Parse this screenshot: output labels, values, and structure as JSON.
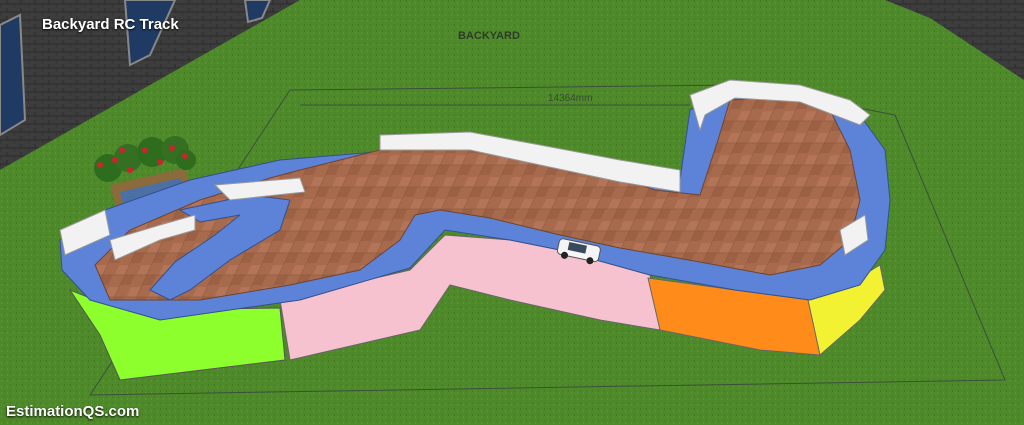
{
  "title": "Backyard RC Track",
  "area_label": "BACKYARD",
  "dimension_label": "14364mm",
  "watermark": "EstimationQS.com",
  "colors": {
    "grass": "#4f8a2a",
    "track_surface": "#a86a4c",
    "track_edge": "#5c83d8",
    "barrier": "#f2f2f2",
    "wall_green": "#8cff2d",
    "wall_pink": "#f7c2d0",
    "wall_orange": "#ff8c1a",
    "wall_yellow": "#f2f233",
    "building": "#3b3b3b"
  },
  "icons": [
    "rc-car-icon",
    "flower-planter-icon",
    "window-icon"
  ]
}
